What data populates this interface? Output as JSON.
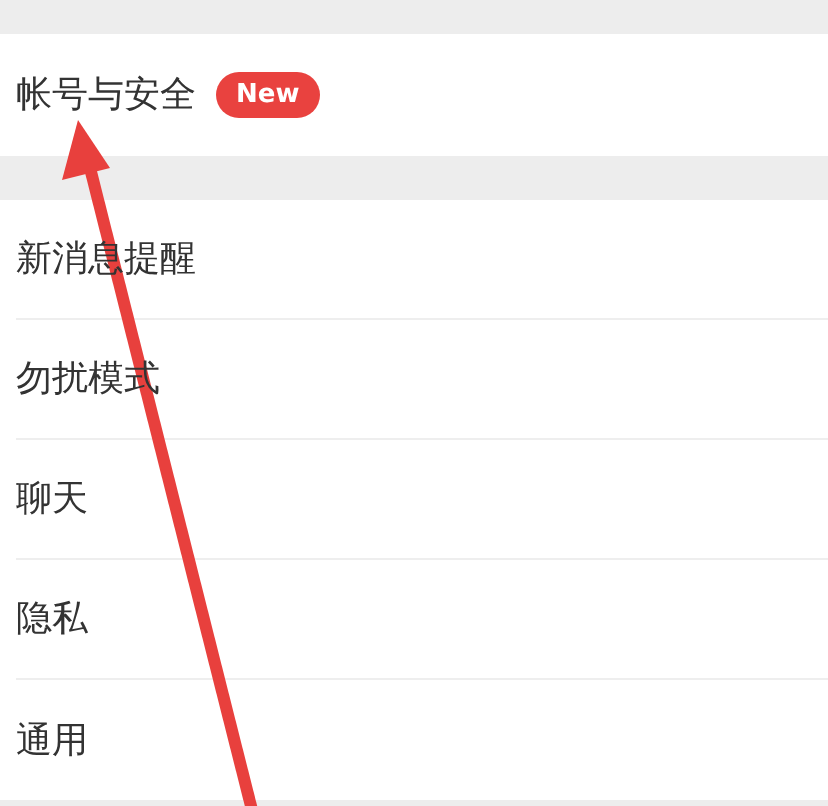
{
  "sections": [
    {
      "items": [
        {
          "label": "帐号与安全",
          "badge": "New"
        }
      ]
    },
    {
      "items": [
        {
          "label": "新消息提醒"
        },
        {
          "label": "勿扰模式"
        },
        {
          "label": "聊天"
        },
        {
          "label": "隐私"
        },
        {
          "label": "通用"
        }
      ]
    }
  ]
}
